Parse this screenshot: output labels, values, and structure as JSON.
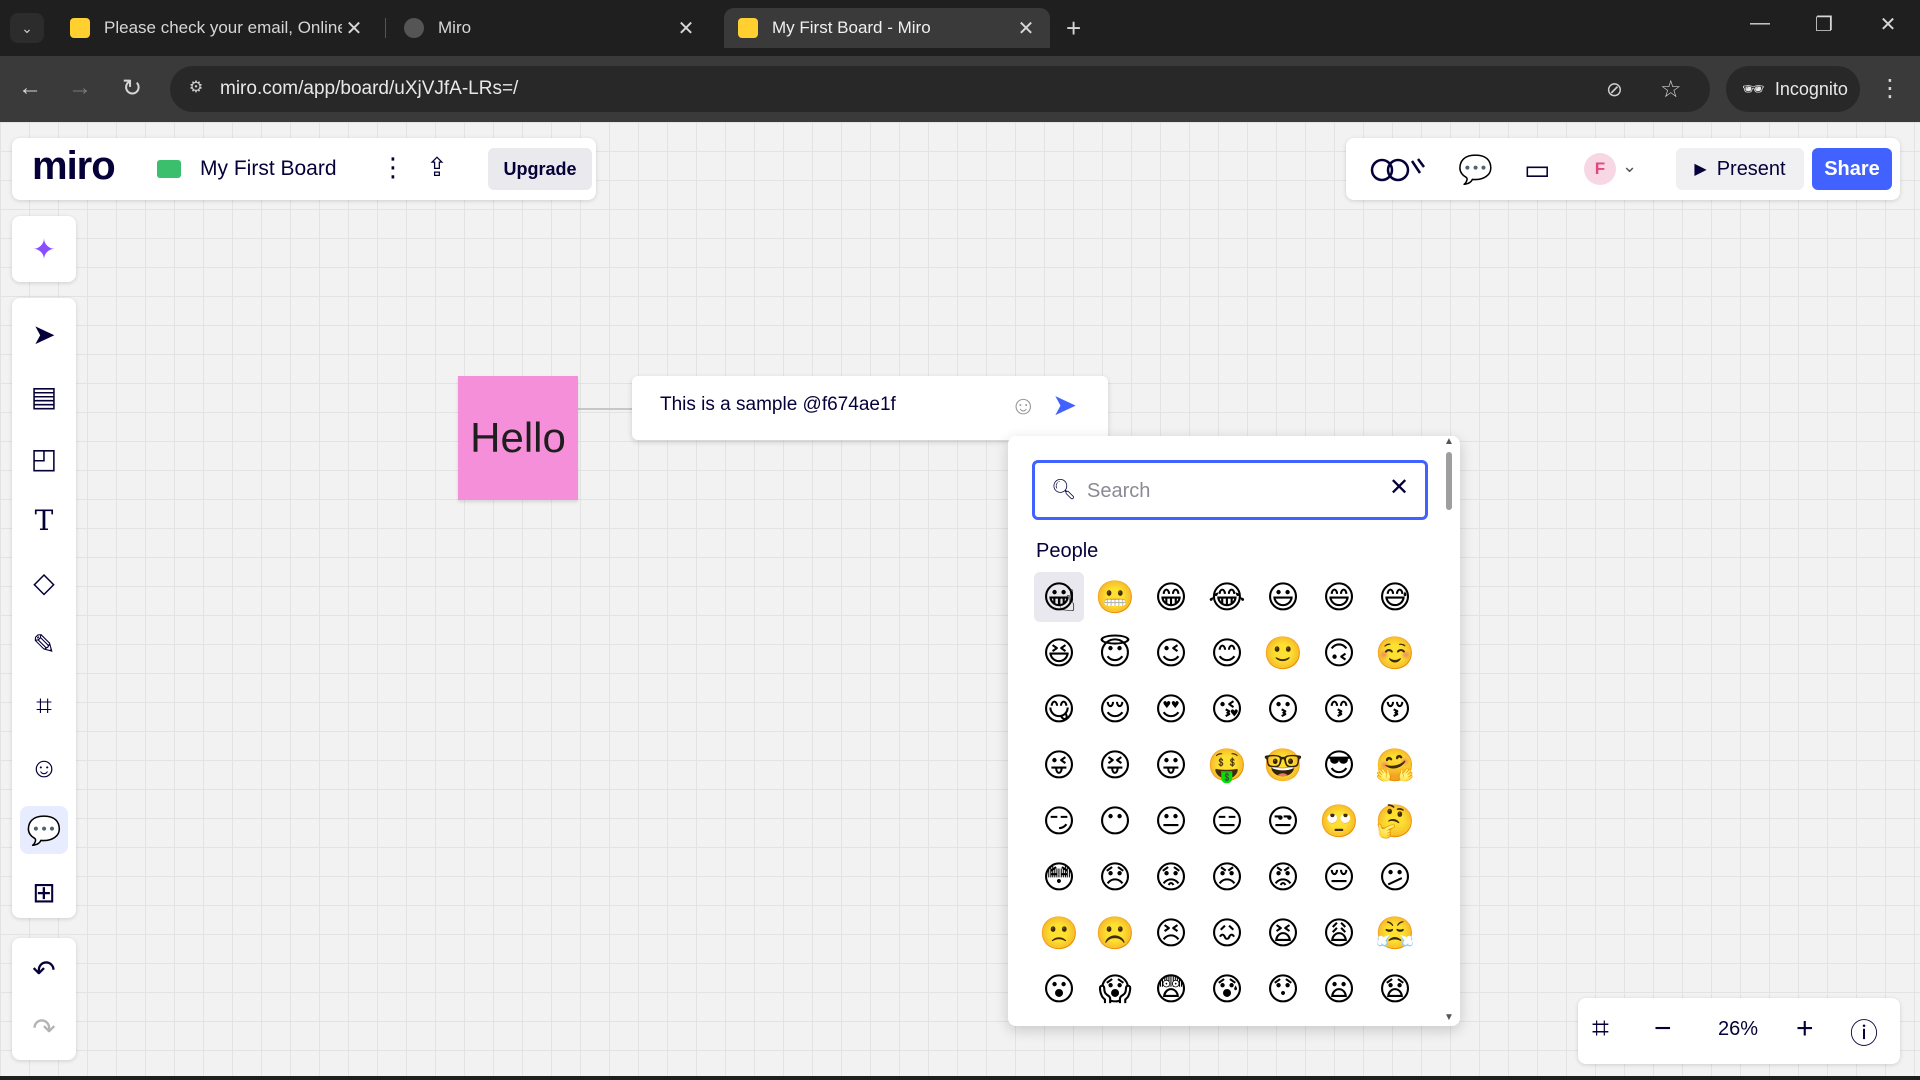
{
  "browser": {
    "tabs": [
      {
        "title": "Please check your email, Online",
        "favicon_color": "#ffd02f"
      },
      {
        "title": "Miro",
        "favicon_color": "#555555"
      },
      {
        "title": "My First Board - Miro",
        "favicon_color": "#ffd02f"
      }
    ],
    "close_glyph": "✕",
    "new_tab_glyph": "+",
    "url": "miro.com/app/board/uXjVJfA-LRs=/",
    "incognito_label": "Incognito"
  },
  "board": {
    "logo": "miro",
    "name": "My First Board",
    "upgrade_label": "Upgrade",
    "present_label": "Present",
    "share_label": "Share",
    "avatar_initial": "F"
  },
  "sticky_note": {
    "text": "Hello",
    "color": "#f58fd9"
  },
  "comment": {
    "text": "This is a sample @f674ae1f"
  },
  "emoji_picker": {
    "search_placeholder": "Search",
    "section_label": "People",
    "emojis": [
      "😀",
      "😬",
      "😁",
      "😂",
      "😃",
      "😄",
      "😅",
      "😆",
      "😇",
      "😉",
      "😊",
      "🙂",
      "🙃",
      "☺️",
      "😋",
      "😌",
      "😍",
      "😘",
      "😗",
      "😙",
      "😚",
      "😜",
      "😝",
      "😛",
      "🤑",
      "🤓",
      "😎",
      "🤗",
      "😏",
      "😶",
      "😐",
      "😑",
      "😒",
      "🙄",
      "🤔",
      "😳",
      "😞",
      "😟",
      "😠",
      "😡",
      "😔",
      "😕",
      "🙁",
      "☹️",
      "😣",
      "😖",
      "😫",
      "😩",
      "😤",
      "😮",
      "😱",
      "😨",
      "😰",
      "😯",
      "😦",
      "😧"
    ]
  },
  "zoom": {
    "level": "26%"
  },
  "colors": {
    "accent": "#4262ff",
    "brand_dark": "#050038"
  }
}
